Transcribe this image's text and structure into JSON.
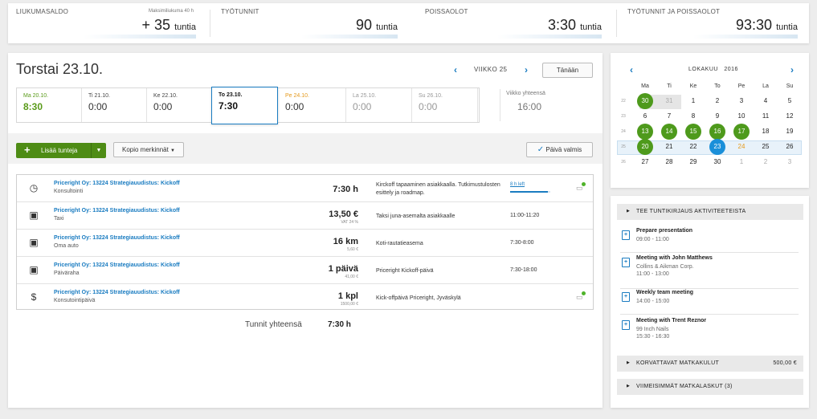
{
  "summary": {
    "balance": {
      "label": "LIUKUMASALDO",
      "sub": "Maksimiliukuma 40 h",
      "value": "+ 35",
      "unit": "tuntia"
    },
    "work": {
      "label": "TYÖTUNNIT",
      "value": "90",
      "unit": "tuntia"
    },
    "absence": {
      "label": "POISSAOLOT",
      "value": "3:30",
      "unit": "tuntia"
    },
    "total": {
      "label": "TYÖTUNNIT JA POISSAOLOT",
      "value": "93:30",
      "unit": "tuntia"
    }
  },
  "day": {
    "title": "Torstai 23.10.",
    "week_label": "VIIKKO 25",
    "today_button": "Tänään",
    "prev_icon": "chevron-left-icon",
    "next_icon": "chevron-right-icon"
  },
  "days": [
    {
      "name": "Ma 20.10.",
      "value": "8:30",
      "state": "green"
    },
    {
      "name": "Ti 21.10.",
      "value": "0:00",
      "state": ""
    },
    {
      "name": "Ke 22.10.",
      "value": "0:00",
      "state": ""
    },
    {
      "name": "To 23.10.",
      "value": "7:30",
      "state": "sel"
    },
    {
      "name": "Pe 24.10.",
      "value": "0:00",
      "state": "orange"
    },
    {
      "name": "La 25.10.",
      "value": "0:00",
      "state": "gray"
    },
    {
      "name": "Su 26.10.",
      "value": "0:00",
      "state": "gray"
    }
  ],
  "week_total": {
    "label": "Viikko yhteensä",
    "value": "16:00"
  },
  "toolbar": {
    "add": "Lisää tunteja",
    "copy": "Kopio merkinnät",
    "done": "Päivä valmis"
  },
  "entries": [
    {
      "icon": "clock-icon",
      "project": "Priceright Oy: 13224 Strategiauudistus: Kickoff",
      "type": "Konsultointi",
      "amount": "7:30 h",
      "amount_sub": "",
      "desc": "Kirckoff tapaaminen asiakkaalla. Tutkimustulosten esittely ja roadmap.",
      "time": "",
      "left": "8 h left",
      "progress": 0.94,
      "comment": true
    },
    {
      "icon": "briefcase-icon",
      "project": "Priceright Oy: 13224 Strategiauudistus: Kickoff",
      "type": "Taxi",
      "amount": "13,50 €",
      "amount_sub": "VAT 24 %",
      "desc": "Taksi juna-asemalta asiakkaalle",
      "time": "11:00-11:20",
      "left": "",
      "comment": false
    },
    {
      "icon": "briefcase-icon",
      "project": "Priceright Oy: 13224 Strategiauudistus: Kickoff",
      "type": "Oma auto",
      "amount": "16 km",
      "amount_sub": "5,60 €",
      "desc": "Koti-rautatieasema",
      "time": "7:30-8:00",
      "left": "",
      "comment": false
    },
    {
      "icon": "briefcase-icon",
      "project": "Priceright Oy: 13224 Strategiauudistus: Kickoff",
      "type": "Päiväraha",
      "amount": "1 päivä",
      "amount_sub": "41,00 €",
      "desc": "Priceright Kickoff-päivä",
      "time": "7:30-18:00",
      "left": "",
      "comment": false
    },
    {
      "icon": "receipt-icon",
      "project": "Priceright Oy: 13224 Strategiauudistus: Kickoff",
      "type": "Konsutointipäivä",
      "amount": "1 kpl",
      "amount_sub": "1500,00 €",
      "desc": "Kick-offpäivä Priceright, Jyväskylä",
      "time": "",
      "left": "",
      "comment": true
    }
  ],
  "totals": {
    "label": "Tunnit yhteensä",
    "value": "7:30 h"
  },
  "calendar": {
    "month": "LOKAKUU",
    "year": "2016",
    "weekdays": [
      "Ma",
      "Ti",
      "Ke",
      "To",
      "Pe",
      "La",
      "Su"
    ],
    "weeks": [
      {
        "no": "22",
        "days": [
          {
            "d": "30",
            "s": "g"
          },
          {
            "d": "31",
            "s": "muted"
          },
          {
            "d": "1",
            "s": ""
          },
          {
            "d": "2",
            "s": ""
          },
          {
            "d": "3",
            "s": ""
          },
          {
            "d": "4",
            "s": ""
          },
          {
            "d": "5",
            "s": ""
          }
        ]
      },
      {
        "no": "23",
        "days": [
          {
            "d": "6",
            "s": ""
          },
          {
            "d": "7",
            "s": ""
          },
          {
            "d": "8",
            "s": ""
          },
          {
            "d": "9",
            "s": ""
          },
          {
            "d": "10",
            "s": ""
          },
          {
            "d": "11",
            "s": ""
          },
          {
            "d": "12",
            "s": ""
          }
        ]
      },
      {
        "no": "24",
        "days": [
          {
            "d": "13",
            "s": "g"
          },
          {
            "d": "14",
            "s": "g"
          },
          {
            "d": "15",
            "s": "g"
          },
          {
            "d": "16",
            "s": "g"
          },
          {
            "d": "17",
            "s": "g"
          },
          {
            "d": "18",
            "s": ""
          },
          {
            "d": "19",
            "s": ""
          }
        ]
      },
      {
        "no": "25",
        "days": [
          {
            "d": "20",
            "s": "g"
          },
          {
            "d": "21",
            "s": ""
          },
          {
            "d": "22",
            "s": ""
          },
          {
            "d": "23",
            "s": "b"
          },
          {
            "d": "24",
            "s": "or"
          },
          {
            "d": "25",
            "s": ""
          },
          {
            "d": "26",
            "s": ""
          }
        ]
      },
      {
        "no": "26",
        "days": [
          {
            "d": "27",
            "s": ""
          },
          {
            "d": "28",
            "s": ""
          },
          {
            "d": "29",
            "s": ""
          },
          {
            "d": "30",
            "s": ""
          },
          {
            "d": "1",
            "s": "muted"
          },
          {
            "d": "2",
            "s": "muted"
          },
          {
            "d": "3",
            "s": "muted"
          }
        ]
      }
    ]
  },
  "sidebar": {
    "activities_header": "TEE TUNTIKIRJAUS AKTIVITEETEISTA",
    "activities": [
      {
        "title": "Prepare presentation",
        "company": "",
        "time": "09:00 - 11:00"
      },
      {
        "title": "Meeting with John Matthews",
        "company": "Collins & Aikman Corp.",
        "time": "11:00 - 13:00"
      },
      {
        "title": "Weekly team meeting",
        "company": "",
        "time": "14:00 - 15:00"
      },
      {
        "title": "Meeting with Trent Reznor",
        "company": "99 Inch Nails",
        "time": "15:30 - 16:30"
      }
    ],
    "travel_header": "KORVATTAVAT MATKAKULUT",
    "travel_value": "500,00 €",
    "recent_header": "VIIMEISIMMÄT MATKALASKUT (3)"
  }
}
